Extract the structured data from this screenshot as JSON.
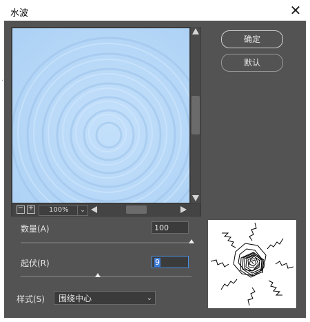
{
  "window": {
    "title": "水波",
    "close_glyph": "✕"
  },
  "preview": {
    "zoom": "100%",
    "zoom_out_glyph": "−",
    "zoom_in_glyph": "+",
    "caret": "⌄"
  },
  "buttons": {
    "ok": "确定",
    "default": "默认"
  },
  "params": {
    "amount": {
      "label": "数量(A)",
      "value": "100",
      "slider_fraction": 1.0
    },
    "ridges": {
      "label": "起伏(R)",
      "value": "9",
      "slider_fraction": 0.45
    }
  },
  "style": {
    "label": "样式(S)",
    "selected": "围绕中心",
    "caret": "⌄"
  },
  "colors": {
    "dialog_bg": "#535353",
    "preview_water": "#b7d8f6",
    "focus_border": "#4a90e2"
  },
  "icons": {
    "close": "close-icon",
    "scroll_up": "arrow-up-icon",
    "scroll_down": "arrow-down-icon",
    "scroll_left": "arrow-left-icon",
    "scroll_right": "arrow-right-icon"
  }
}
